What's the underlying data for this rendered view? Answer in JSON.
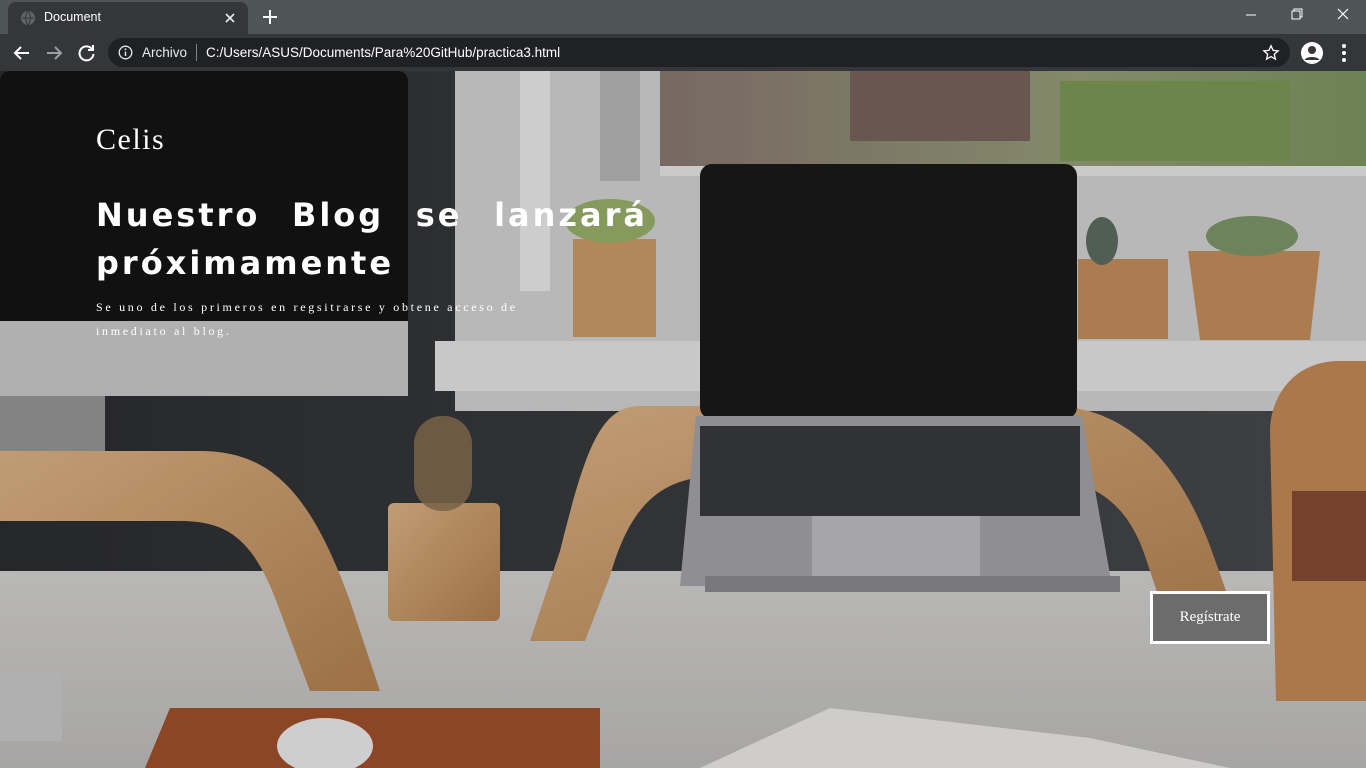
{
  "browser": {
    "tab_title": "Document",
    "scheme_label": "Archivo",
    "url": "C:/Users/ASUS/Documents/Para%20GitHub/practica3.html",
    "icons": [
      "globe-icon",
      "close-icon",
      "plus-icon",
      "minimize-icon",
      "maximize-icon",
      "window-close-icon",
      "back-arrow-icon",
      "forward-arrow-icon",
      "reload-icon",
      "info-icon",
      "star-icon",
      "profile-icon",
      "kebab-menu-icon"
    ]
  },
  "page": {
    "brand": "Celis",
    "headline": "Nuestro Blog se lanzará próximamente",
    "subtitle": "Se uno de los primeros en regsitrarse y obtene acceso de inmediato al blog.",
    "cta_label": "Regístrate"
  },
  "colors": {
    "tabbar": "#4f5457",
    "toolbar": "#35363a",
    "omnibox": "#202124",
    "cta_bg": "#6c6c6c",
    "text": "#ffffff"
  }
}
